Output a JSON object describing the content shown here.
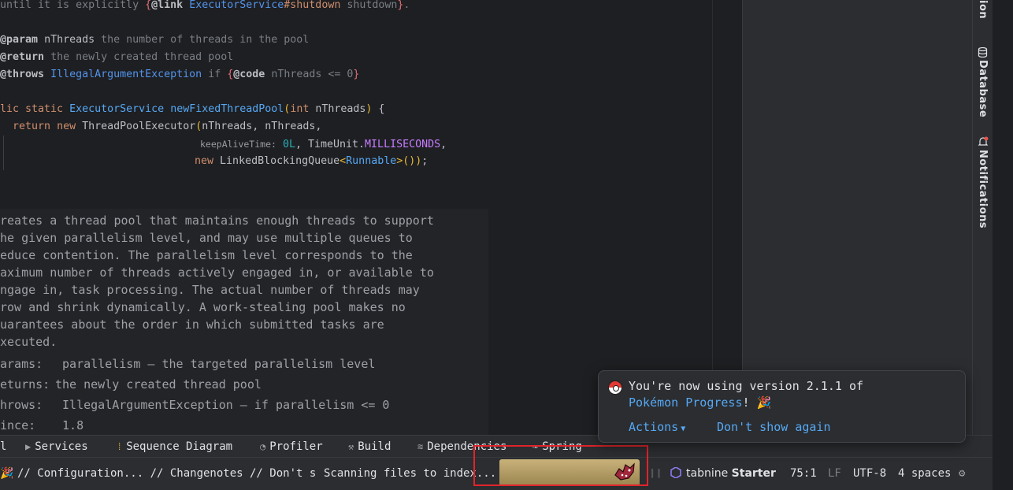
{
  "editor": {
    "line1": {
      "pre": "until it is explicitly ",
      "tag": "@link",
      "ref": "ExecutorService",
      "member": "#shutdown",
      "label": "shutdown",
      "post": "."
    },
    "param": {
      "tag": "@param",
      "name": "nThreads",
      "text": "the number of threads in the pool"
    },
    "ret": {
      "tag": "@return",
      "text": "the newly created thread pool"
    },
    "throws": {
      "tag": "@throws",
      "exc": "IllegalArgumentException",
      "if": "if",
      "code_tag": "@code",
      "code": "nThreads <= 0"
    },
    "sig": {
      "kw1": "lic static",
      "ret_type": "ExecutorService",
      "name": "newFixedThreadPool",
      "param_kw": "int",
      "param": "nThreads"
    },
    "return_line": {
      "kw": "return",
      "new_kw": "new",
      "cls": "ThreadPoolExecutor",
      "args": "nThreads, nThreads,"
    },
    "hint_line": {
      "hint": "keepAliveTime:",
      "num": "0L",
      "unit": "TimeUnit",
      "const": "MILLISECONDS"
    },
    "queue_line": {
      "new_kw": "new",
      "cls": "LinkedBlockingQueue",
      "gen": "Runnable"
    }
  },
  "rendered_doc": {
    "lines": [
      "reates a thread pool that maintains enough threads to support",
      "he given parallelism level, and may use multiple queues to",
      "educe contention. The parallelism level corresponds to the",
      "aximum number of threads actively engaged in, or available to",
      "ngage in, task processing. The actual number of threads may",
      "row and shrink dynamically. A work-stealing pool makes no",
      "uarantees about the order in which submitted tasks are",
      "xecuted."
    ],
    "params_label": "arams:",
    "params_value": "parallelism – the targeted parallelism level",
    "returns_label": "eturns:",
    "returns_value": "the newly created thread pool",
    "throws_label": "hrows:",
    "throws_value": "IllegalArgumentException – if parallelism <= 0",
    "since_label": "ince:",
    "since_value": "1.8"
  },
  "side_tools": {
    "top": "ion",
    "database": "Database",
    "notifications": "Notifications"
  },
  "tool_tabs": {
    "partial": "l",
    "services": "Services",
    "sequence": "Sequence Diagram",
    "profiler": "Profiler",
    "build": "Build",
    "dependencies": "Dependencies",
    "spring": "Spring"
  },
  "status_bar": {
    "message": "// Configuration... // Changenotes // Don't s",
    "indexing": "Scanning files to index...",
    "tabnine": "tabnine",
    "tabnine_plan": "Starter",
    "position": "75:1",
    "line_sep": "LF",
    "encoding": "UTF-8",
    "indent": "4 spaces"
  },
  "popup": {
    "line1": "You're now using version 2.1.1 of",
    "plugin": "Pokémon Progress",
    "excl": "!",
    "emoji": "🎉",
    "actions": "Actions",
    "dismiss": "Don't show again"
  },
  "colors": {
    "accent": "#56a8f5",
    "highlight_box": "#e0242b",
    "progress": "#c9b27a"
  }
}
